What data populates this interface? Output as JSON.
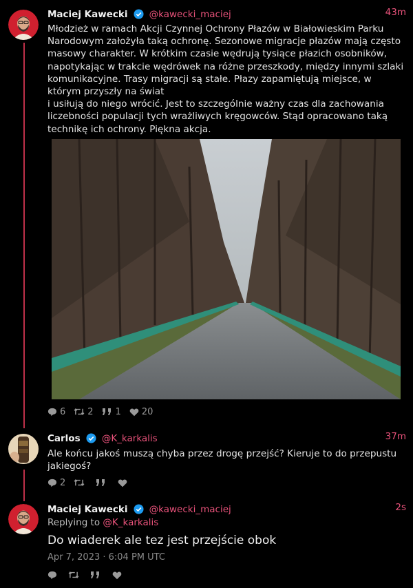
{
  "post1": {
    "name": "Maciej Kawecki",
    "handle": "@kawecki_maciej",
    "time": "43m",
    "paragraph1": "Młodzież w ramach Akcji Czynnej Ochrony Płazów w Białowieskim Parku Narodowym założyła taką ochronę. Sezonowe migracje płazów mają często masowy charakter. W krótkim czasie wędrują tysiące płazich osobników, napotykając w trakcie wędrówek na różne przeszkody, między innymi szlaki komunikacyjne. Trasy migracji są stałe. Płazy zapamiętują miejsce, w którym przyszły na świat",
    "paragraph2": "i usiłują do niego wrócić. Jest to szczególnie ważny czas dla zachowania liczebności populacji tych wrażliwych kręgowców. Stąd opracowano taką technikę ich ochrony. Piękna akcja.",
    "replies": "6",
    "reposts": "2",
    "quotes": "1",
    "likes": "20"
  },
  "post2": {
    "name": "Carlos",
    "handle": "@K_karkalis",
    "time": "37m",
    "text": "Ale końcu jakoś muszą chyba przez drogę przejść? Kieruje to do przepustu jakiegoś?",
    "replies": "2"
  },
  "post3": {
    "name": "Maciej Kawecki",
    "handle": "@kawecki_maciej",
    "time": "2s",
    "replying_prefix": "Replying to ",
    "replying_handle": "@K_karkalis",
    "text": "Do wiaderek ale tez jest przejście obok",
    "datetime": "Apr 7, 2023 · 6:04 PM UTC"
  },
  "colors": {
    "accent": "#e8527a",
    "thread": "#c0304a",
    "verified": "#1d9bf0"
  },
  "icons": [
    "verified-icon",
    "reply-icon",
    "repost-icon",
    "quote-icon",
    "heart-icon"
  ]
}
